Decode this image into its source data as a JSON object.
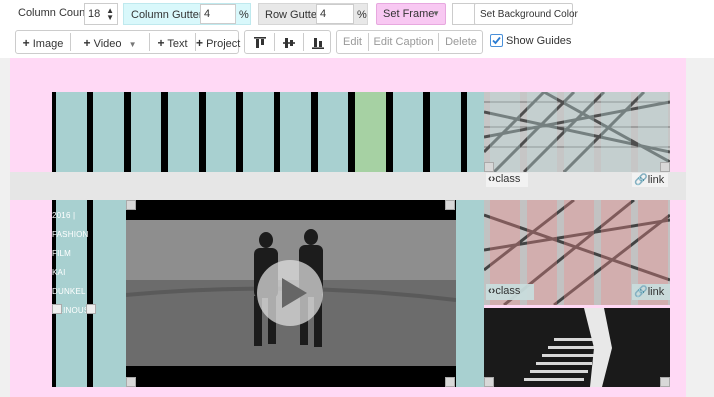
{
  "toolbar": {
    "column_count_label": "Column Count",
    "column_count_value": "18",
    "column_gutter_label": "Column Gutter",
    "column_gutter_value": "4",
    "column_gutter_unit": "%",
    "row_gutter_label": "Row Gutter",
    "row_gutter_value": "4",
    "row_gutter_unit": "%",
    "set_frame_label": "Set Frame",
    "set_bg_color_label": "Set Background Color",
    "add_image": "Image",
    "add_video": "Video",
    "add_text": "Text",
    "add_project": "Project",
    "edit": "Edit",
    "edit_caption": "Edit Caption",
    "delete": "Delete",
    "show_guides": "Show Guides",
    "show_guides_checked": true
  },
  "grid": {
    "caption_class": "class",
    "caption_link": "link",
    "caption_class_2": "class",
    "caption_link_2": "link",
    "text_block_lines": [
      "2016 |",
      "FASHION",
      "FILM",
      "KAI",
      "DUNKEL",
      "GLINOUS"
    ]
  },
  "colors": {
    "guide_column": "#a8d0d0",
    "selected_column": "#a6d1a3",
    "frame": "#ffd9f5",
    "gutter": "#e6e6e6",
    "column_gutter_field": "#d9f8fb",
    "row_gutter_field": "#e8e8e8",
    "set_frame_button": "#f8c8f2"
  }
}
